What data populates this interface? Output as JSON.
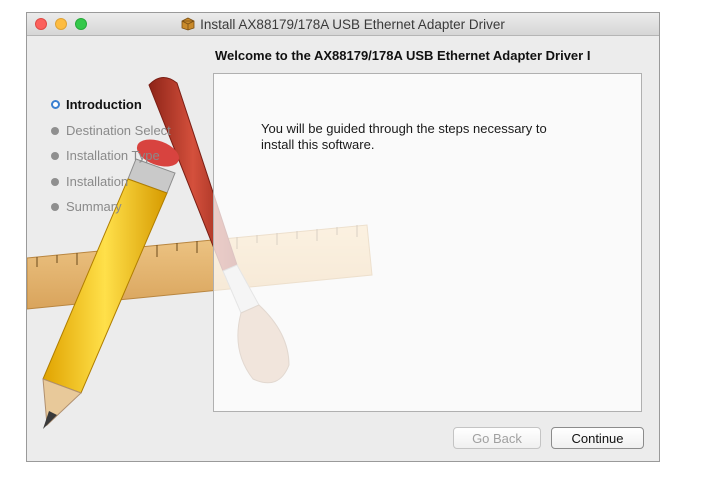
{
  "window": {
    "title": "Install AX88179/178A USB Ethernet Adapter Driver",
    "header_title": "Welcome to the AX88179/178A USB Ethernet Adapter Driver I",
    "traffic_lights": {
      "close_color": "#fc605c",
      "minimize_color": "#fdbc40",
      "maximize_color": "#34c84a"
    }
  },
  "sidebar": {
    "steps": [
      {
        "label": "Introduction",
        "active": true
      },
      {
        "label": "Destination Select",
        "active": false
      },
      {
        "label": "Installation Type",
        "active": false
      },
      {
        "label": "Installation",
        "active": false
      },
      {
        "label": "Summary",
        "active": false
      }
    ]
  },
  "content": {
    "message_line1": "You will be guided through the steps necessary to",
    "message_line2": "install this software."
  },
  "buttons": {
    "back_label": "Go Back",
    "continue_label": "Continue"
  },
  "colors": {
    "active_step": "#3a7fd0",
    "window_bg": "#ececec"
  },
  "icons": [
    "package-icon",
    "pencil-illustration",
    "brush-illustration",
    "ruler-illustration"
  ]
}
